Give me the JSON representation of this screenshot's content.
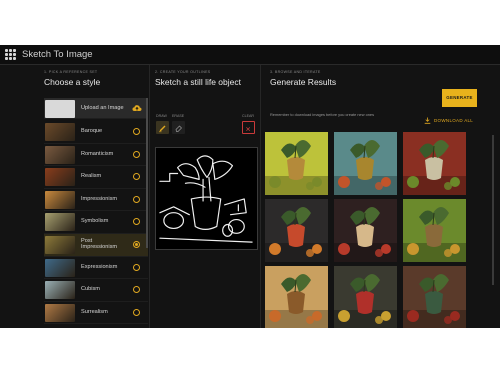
{
  "app": {
    "title": "Sketch To Image",
    "logo_icon": "grid-logo-icon"
  },
  "step1": {
    "label": "1. Pick a reference set",
    "heading": "Choose a style",
    "upload_label": "Upload an Image",
    "styles": [
      {
        "name": "Baroque",
        "selected": false,
        "thumb_color": "#6b4a2a"
      },
      {
        "name": "Romanticism",
        "selected": false,
        "thumb_color": "#7a5a40"
      },
      {
        "name": "Realism",
        "selected": false,
        "thumb_color": "#8a3d1c"
      },
      {
        "name": "Impressionism",
        "selected": false,
        "thumb_color": "#c98a3e"
      },
      {
        "name": "Symbolism",
        "selected": false,
        "thumb_color": "#a7a070"
      },
      {
        "name": "Post Impressionism",
        "selected": true,
        "thumb_color": "#8c7a3a"
      },
      {
        "name": "Expressionism",
        "selected": false,
        "thumb_color": "#3f6a8a"
      },
      {
        "name": "Cubism",
        "selected": false,
        "thumb_color": "#9ab0b5"
      },
      {
        "name": "Surrealism",
        "selected": false,
        "thumb_color": "#b07a45"
      }
    ]
  },
  "step2": {
    "label": "2. Create your outlines",
    "heading": "Sketch a still life object",
    "draw_label": "Draw",
    "erase_label": "Erase",
    "clear_label": "Clear"
  },
  "step3": {
    "label": "3. Browse and iterate",
    "heading": "Generate Results",
    "subtitle": "Remember to download images before you create new ones",
    "generate_label": "GENERATE",
    "download_label": "DOWNLOAD ALL",
    "results": [
      {
        "bg": "#bdc23a",
        "vase": "#b48a3a",
        "fruit": "#7a8a2a"
      },
      {
        "bg": "#5a8a8a",
        "vase": "#a8862e",
        "fruit": "#c2542a"
      },
      {
        "bg": "#8a2f22",
        "vase": "#c9c0a2",
        "fruit": "#6b8a2a"
      },
      {
        "bg": "#2c2a2a",
        "vase": "#c64a2c",
        "fruit": "#d27a2a"
      },
      {
        "bg": "#2e2020",
        "vase": "#d6b88a",
        "fruit": "#b83a2a"
      },
      {
        "bg": "#6b8a2c",
        "vase": "#8a6a3a",
        "fruit": "#c9962e"
      },
      {
        "bg": "#c9a060",
        "vase": "#8a5a2a",
        "fruit": "#c86a2a"
      },
      {
        "bg": "#3a3a30",
        "vase": "#b0302a",
        "fruit": "#c9a030"
      },
      {
        "bg": "#5a3a2a",
        "vase": "#3a5a40",
        "fruit": "#9a2a20"
      }
    ]
  }
}
